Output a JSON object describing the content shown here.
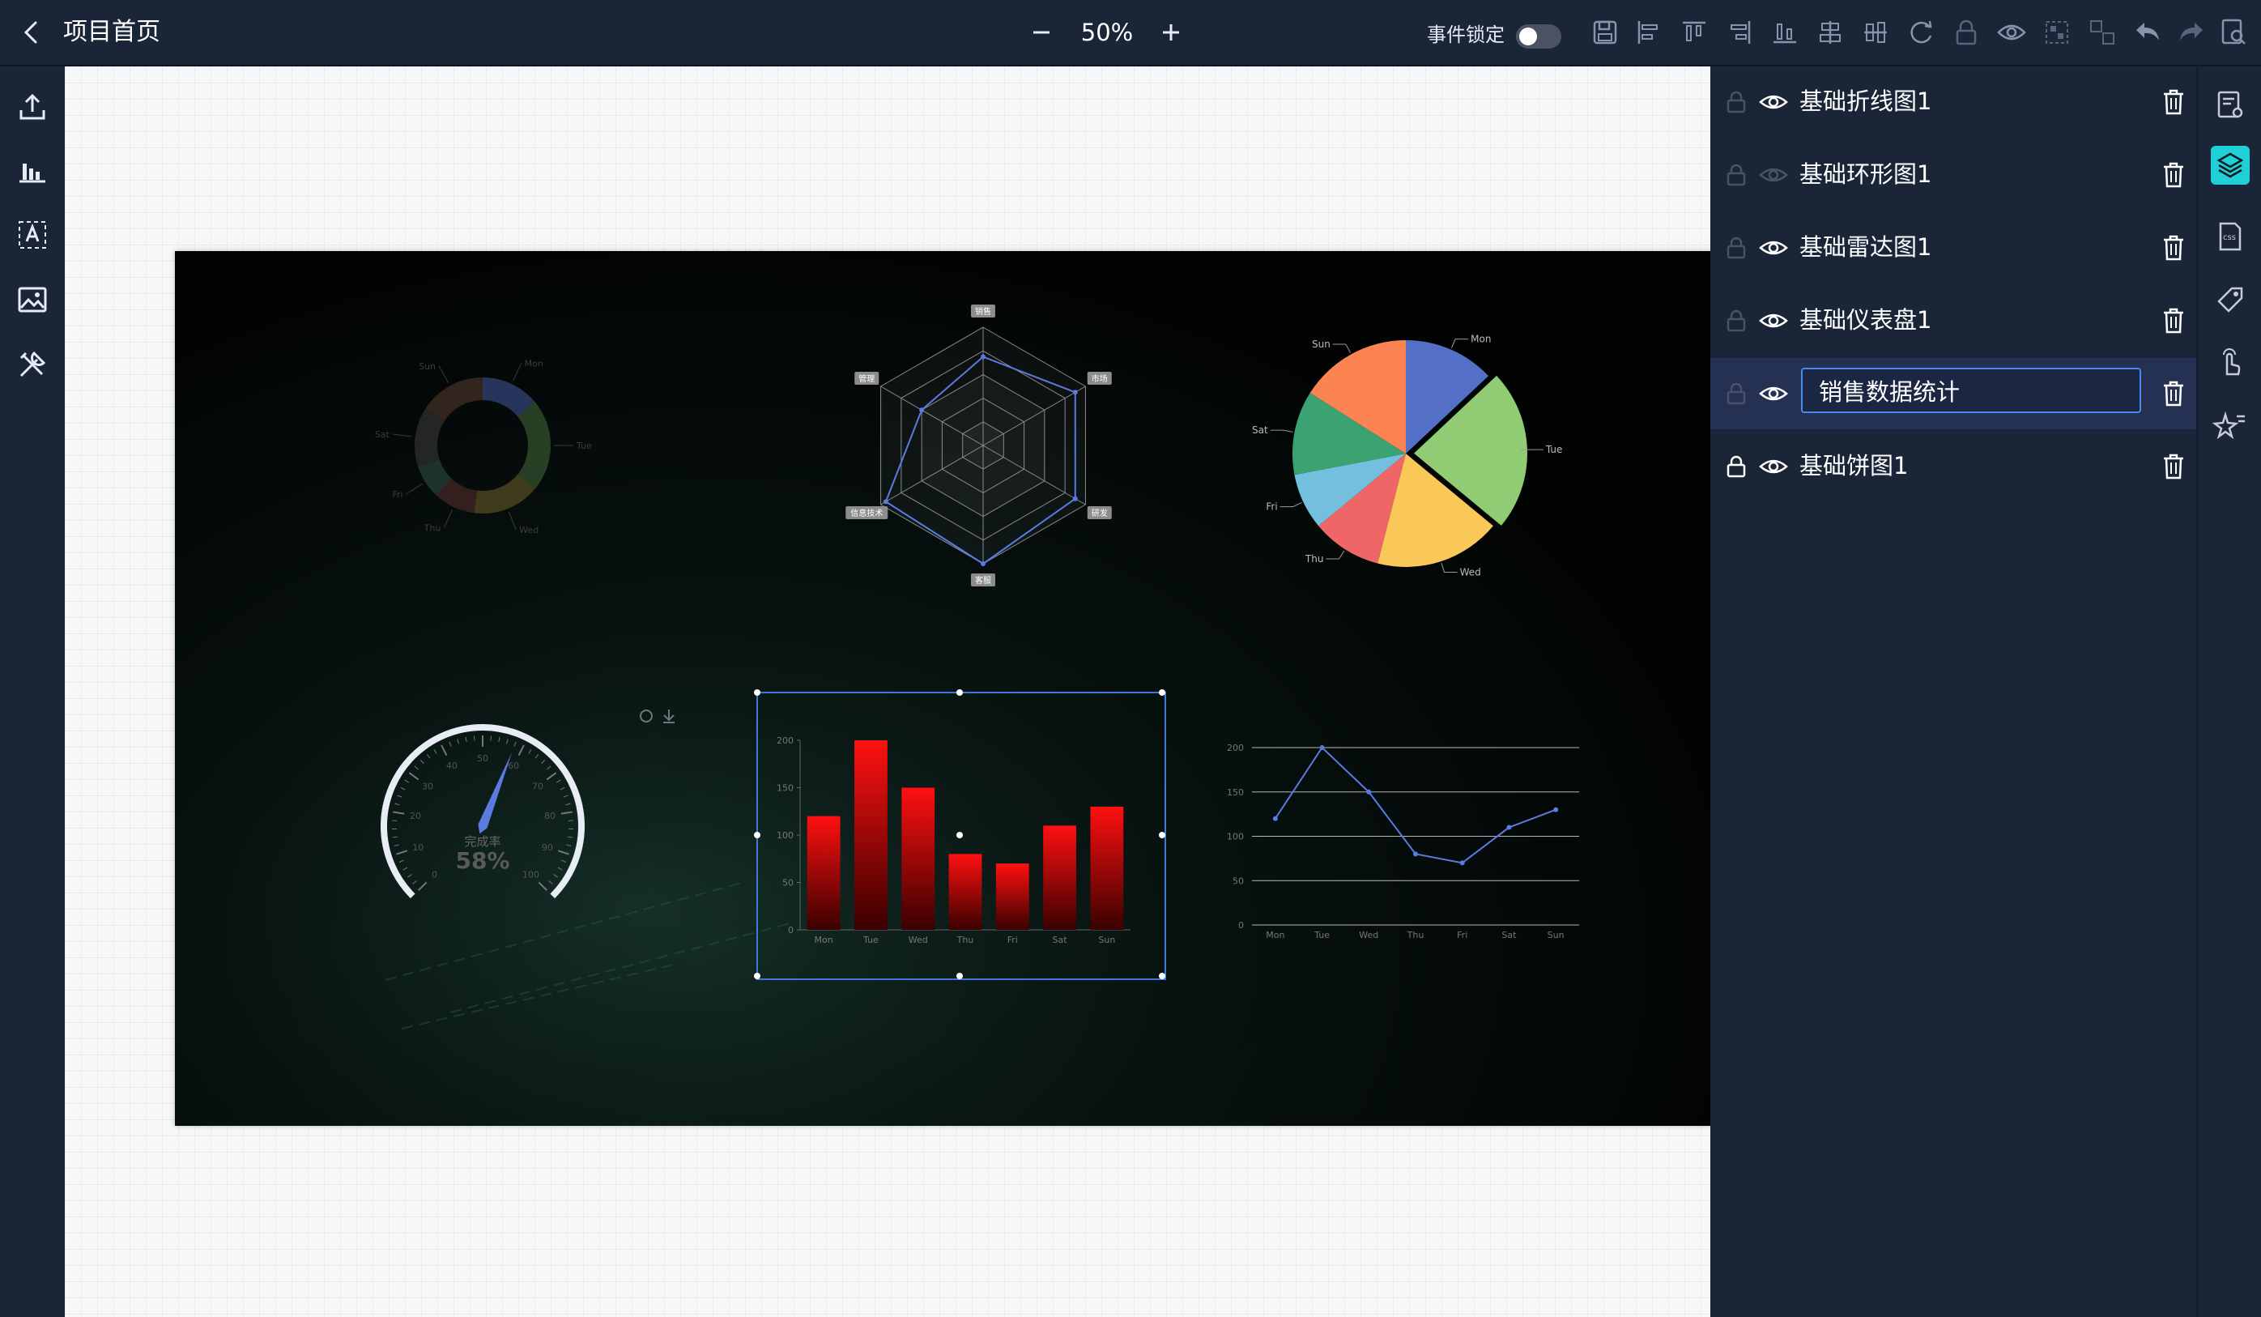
{
  "topbar": {
    "title": "项目首页",
    "zoom": "50%",
    "event_lock_label": "事件锁定",
    "event_lock_on": false,
    "tools": [
      "save-icon",
      "align-left-icon",
      "align-top-icon",
      "align-right-icon",
      "align-bottom-icon",
      "distribute-vertical-icon",
      "distribute-horizontal-icon",
      "refresh-icon",
      "lock-icon",
      "eye-icon",
      "group-icon",
      "ungroup-icon",
      "undo-icon",
      "redo-icon",
      "preview-icon"
    ]
  },
  "left_rail": [
    "upload-icon",
    "chart-icon",
    "text-icon",
    "image-icon",
    "tools-icon"
  ],
  "layers": [
    {
      "name": "基础折线图1",
      "locked": false,
      "visible": true
    },
    {
      "name": "基础环形图1",
      "locked": false,
      "visible": false
    },
    {
      "name": "基础雷达图1",
      "locked": false,
      "visible": true
    },
    {
      "name": "基础仪表盘1",
      "locked": false,
      "visible": true
    },
    {
      "name": "销售数据统计",
      "locked": false,
      "visible": true,
      "editing": true
    },
    {
      "name": "基础饼图1",
      "locked": true,
      "visible": true
    }
  ],
  "right_rail": [
    "page-settings-icon",
    "layers-icon",
    "css-icon",
    "tag-icon",
    "interaction-icon",
    "effects-icon"
  ],
  "colors": {
    "accent": "#1fd1d6",
    "selection": "#3f7ad8",
    "panel_bg": "#1b2538",
    "line_series": "#5b7be0"
  },
  "chart_data": [
    {
      "type": "pie",
      "variant": "donut",
      "categories": [
        "Mon",
        "Tue",
        "Wed",
        "Thu",
        "Fri",
        "Sat",
        "Sun"
      ],
      "values": [
        14,
        22,
        16,
        10,
        8,
        14,
        16
      ],
      "colors": [
        "#2c3d6a",
        "#2e4a2a",
        "#4a4420",
        "#3e2222",
        "#223a32",
        "#2a2a2a",
        "#3a2a22"
      ]
    },
    {
      "type": "radar",
      "indicators": [
        "销售",
        "市场",
        "研发",
        "客服",
        "信息技术",
        "管理"
      ],
      "values": [
        0.75,
        0.9,
        0.9,
        1.0,
        0.95,
        0.6
      ]
    },
    {
      "type": "pie",
      "categories": [
        "Mon",
        "Tue",
        "Wed",
        "Thu",
        "Fri",
        "Sat",
        "Sun"
      ],
      "values": [
        13,
        23,
        18,
        10,
        8,
        12,
        16
      ],
      "colors": [
        "#5470c6",
        "#91cc75",
        "#fac858",
        "#ee6666",
        "#73c0de",
        "#3ba272",
        "#fc8452"
      ]
    },
    {
      "type": "gauge",
      "title": "完成率",
      "value": 58,
      "min": 0,
      "max": 100,
      "ticks": [
        "0",
        "10",
        "20",
        "30",
        "40",
        "50",
        "60",
        "70",
        "80",
        "90",
        "100"
      ],
      "display": "58%"
    },
    {
      "type": "bar",
      "categories": [
        "Mon",
        "Tue",
        "Wed",
        "Thu",
        "Fri",
        "Sat",
        "Sun"
      ],
      "values": [
        120,
        200,
        150,
        80,
        70,
        110,
        130
      ],
      "ylim": [
        0,
        200
      ],
      "yticks": [
        "0",
        "50",
        "100",
        "150",
        "200"
      ]
    },
    {
      "type": "line",
      "categories": [
        "Mon",
        "Tue",
        "Wed",
        "Thu",
        "Fri",
        "Sat",
        "Sun"
      ],
      "values": [
        120,
        200,
        150,
        80,
        70,
        110,
        130
      ],
      "ylim": [
        0,
        200
      ],
      "yticks": [
        "0",
        "50",
        "100",
        "150",
        "200"
      ]
    }
  ]
}
